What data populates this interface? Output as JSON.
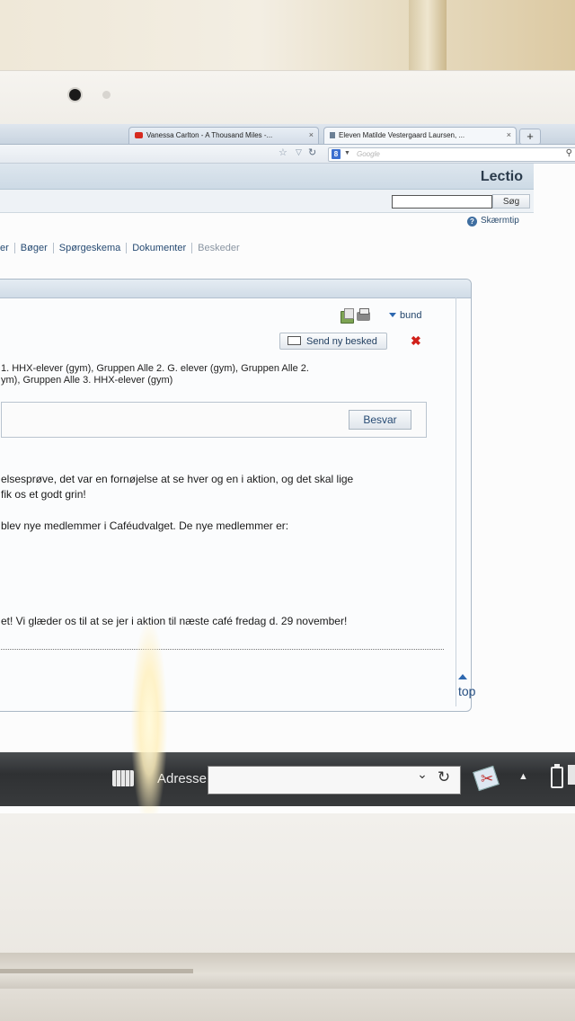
{
  "browser": {
    "tabs": [
      {
        "label": "Vanessa Carlton - A Thousand Miles -...",
        "favicon": "youtube-icon",
        "active": false
      },
      {
        "label": "Eleven Matilde Vestergaard Laursen, ...",
        "favicon": "lectio-icon",
        "active": true
      }
    ],
    "newtab_label": "+",
    "search_placeholder": "Google",
    "search_engine_letter": "8"
  },
  "lectio": {
    "brand": "Lectio",
    "search_button": "Søg",
    "help_label": "Skærmtip",
    "menu": [
      "er",
      "Bøger",
      "Spørgeskema",
      "Dokumenter",
      "Beskeder"
    ]
  },
  "message": {
    "bund_label": "bund",
    "send_button": "Send ny besked",
    "recipients_line1": "1. HHX-elever (gym), Gruppen Alle 2. G. elever (gym), Gruppen Alle 2.",
    "recipients_line2": "ym), Gruppen Alle 3. HHX-elever (gym)",
    "reply_button": "Besvar",
    "body_line1": "elsesprøve, det var en fornøjelse at se hver og en i aktion, og det skal lige",
    "body_line2": " fik os et godt grin!",
    "body_line3": "blev nye medlemmer i Caféudvalget. De nye medlemmer er:",
    "body_line4": "et! Vi glæder os til at se jer i aktion til næste café fredag d. 29 november!",
    "top_label": "top"
  },
  "taskbar": {
    "address_label": "Adresse",
    "address_value": ""
  },
  "colors": {
    "accent": "#2e68b0",
    "delete": "#d0201a",
    "taskbar": "#333537"
  }
}
